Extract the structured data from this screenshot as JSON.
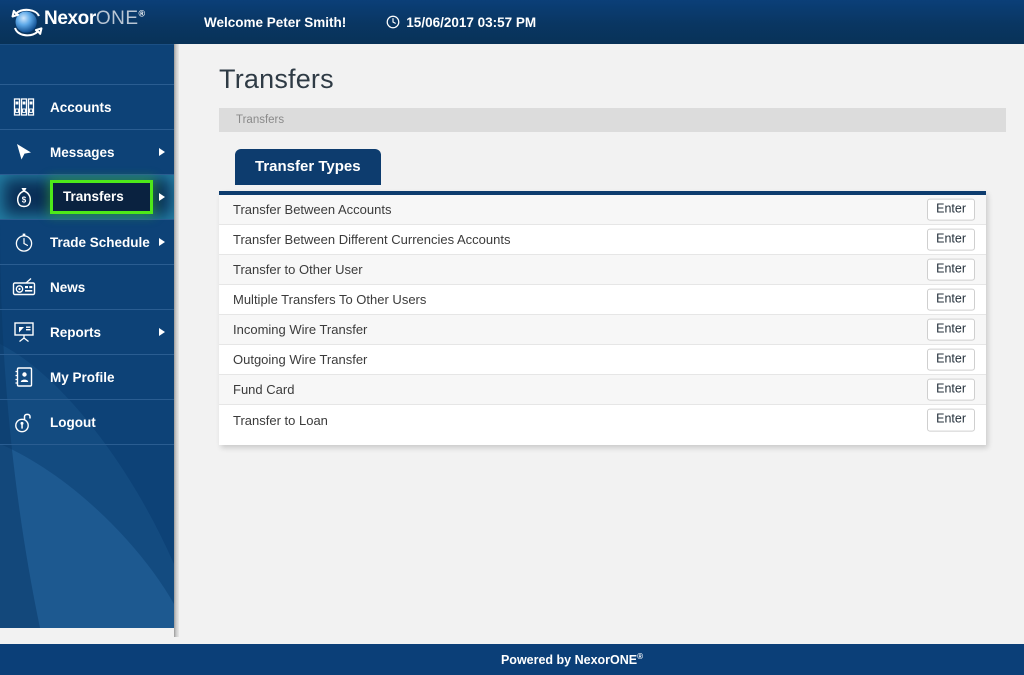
{
  "header": {
    "logo": {
      "part1": "Nexor",
      "part2": "ONE",
      "registered": "®",
      "icon": "nexor-orb-logo"
    },
    "welcome": "Welcome Peter Smith!",
    "clock_icon": "clock-icon",
    "datetime": "15/06/2017 03:57 PM"
  },
  "sidebar": {
    "items": [
      {
        "label": "Accounts",
        "icon": "binders-icon",
        "has_submenu": false,
        "active": false
      },
      {
        "label": "Messages",
        "icon": "cursor-arrow-icon",
        "has_submenu": true,
        "active": false
      },
      {
        "label": "Transfers",
        "icon": "money-bag-icon",
        "has_submenu": true,
        "active": true
      },
      {
        "label": "Trade Schedule",
        "icon": "stopwatch-icon",
        "has_submenu": true,
        "active": false
      },
      {
        "label": "News",
        "icon": "radio-icon",
        "has_submenu": false,
        "active": false
      },
      {
        "label": "Reports",
        "icon": "presentation-icon",
        "has_submenu": true,
        "active": false
      },
      {
        "label": "My Profile",
        "icon": "address-book-icon",
        "has_submenu": false,
        "active": false
      },
      {
        "label": "Logout",
        "icon": "open-padlock-icon",
        "has_submenu": false,
        "active": false
      }
    ]
  },
  "main": {
    "page_title": "Transfers",
    "breadcrumb": "Transfers",
    "tabs": [
      {
        "label": "Transfer Types",
        "selected": true
      }
    ],
    "enter_label": "Enter",
    "transfer_types": [
      "Transfer Between Accounts",
      "Transfer Between Different Currencies Accounts",
      "Transfer to Other User",
      "Multiple Transfers To Other Users",
      "Incoming Wire Transfer",
      "Outgoing Wire Transfer",
      "Fund Card",
      "Transfer to Loan"
    ]
  },
  "footer": {
    "text": "Powered by NexorONE",
    "registered": "®"
  },
  "colors": {
    "header_blue": "#0b3f78",
    "sidebar_blue": "#0d4277",
    "tab_navy": "#0d3c6e",
    "highlight_green": "#4ee819",
    "page_bg": "#f2f2f2",
    "breadcrumb_bg": "#dcdcdc",
    "row_alt": "#f7f7f7"
  }
}
